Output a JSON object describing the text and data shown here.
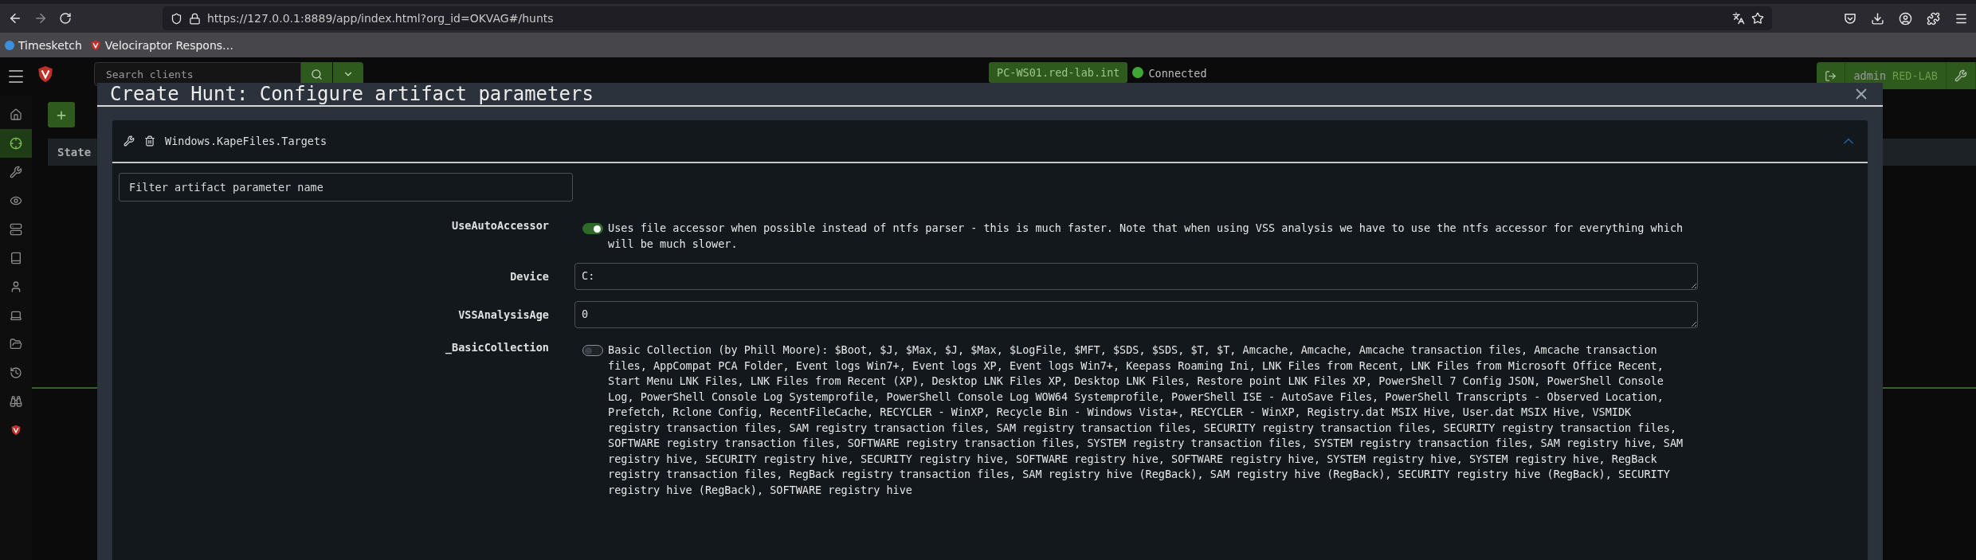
{
  "browser": {
    "url": "https://127.0.0.1:8889/app/index.html?org_id=OKVAG#/hunts",
    "bookmarks": [
      {
        "label": "Timesketch"
      },
      {
        "label": "Velociraptor Respons…"
      }
    ]
  },
  "app": {
    "search": {
      "placeholder": "Search clients"
    },
    "client": "PC-WS01.red-lab.int",
    "connection": {
      "label": "Connected",
      "online": true
    },
    "user": "admin",
    "org": "RED-LAB",
    "sidebar": {
      "items": [
        {
          "selected": false
        },
        {
          "selected": true
        },
        {
          "selected": false
        },
        {
          "selected": false
        },
        {
          "selected": false
        },
        {
          "selected": false
        },
        {
          "selected": false
        },
        {
          "selected": false
        },
        {
          "selected": false
        },
        {
          "selected": false
        },
        {
          "selected": false
        },
        {
          "selected": false
        }
      ]
    },
    "toolbar": {
      "buttons": [
        "+"
      ]
    },
    "table": {
      "columns": [
        "State"
      ]
    }
  },
  "modal": {
    "title": "Create Hunt: Configure artifact parameters",
    "artifact": {
      "name": "Windows.KapeFiles.Targets",
      "expanded": true
    },
    "filter": {
      "placeholder": "Filter artifact parameter name"
    },
    "parameters": [
      {
        "name": "UseAutoAccessor",
        "kind": "toggle",
        "on": true,
        "description": "Uses file accessor when possible instead of ntfs parser - this is much faster. Note that when using VSS analysis we have to use the ntfs accessor for everything which will be much slower."
      },
      {
        "name": "Device",
        "kind": "text",
        "value": "C:"
      },
      {
        "name": "VSSAnalysisAge",
        "kind": "text",
        "value": "0"
      },
      {
        "name": "_BasicCollection",
        "kind": "toggle",
        "on": false,
        "description": "Basic Collection (by Phill Moore): $Boot, $J, $Max, $J, $Max, $LogFile, $MFT, $SDS, $SDS, $T, $T, Amcache, Amcache, Amcache transaction files, Amcache transaction files, AppCompat PCA Folder, Event logs Win7+, Event logs XP, Event logs Win7+, Keepass Roaming Ini, LNK Files from Recent, LNK Files from Microsoft Office Recent, Start Menu LNK Files, LNK Files from Recent (XP), Desktop LNK Files XP, Desktop LNK Files, Restore point LNK Files XP, PowerShell 7 Config JSON, PowerShell Console Log, PowerShell Console Log Systemprofile, PowerShell Console Log WOW64 Systemprofile, PowerShell ISE - AutoSave Files, PowerShell Transcripts - Observed Location, Prefetch, Rclone Config, RecentFileCache, RECYCLER - WinXP, Recycle Bin - Windows Vista+, RECYCLER - WinXP, Registry.dat MSIX Hive, User.dat MSIX Hive, VSMIDK registry transaction files, SAM registry transaction files, SAM registry transaction files, SECURITY registry transaction files, SECURITY registry transaction files, SOFTWARE registry transaction files, SOFTWARE registry transaction files, SYSTEM registry transaction files, SYSTEM registry transaction files, SAM registry hive, SAM registry hive, SECURITY registry hive, SECURITY registry hive, SOFTWARE registry hive, SOFTWARE registry hive, SYSTEM registry hive, SYSTEM registry hive, RegBack registry transaction files, RegBack registry transaction files, SAM registry hive (RegBack), SAM registry hive (RegBack), SECURITY registry hive (RegBack), SECURITY registry hive (RegBack), SOFTWARE registry hive"
      }
    ]
  }
}
